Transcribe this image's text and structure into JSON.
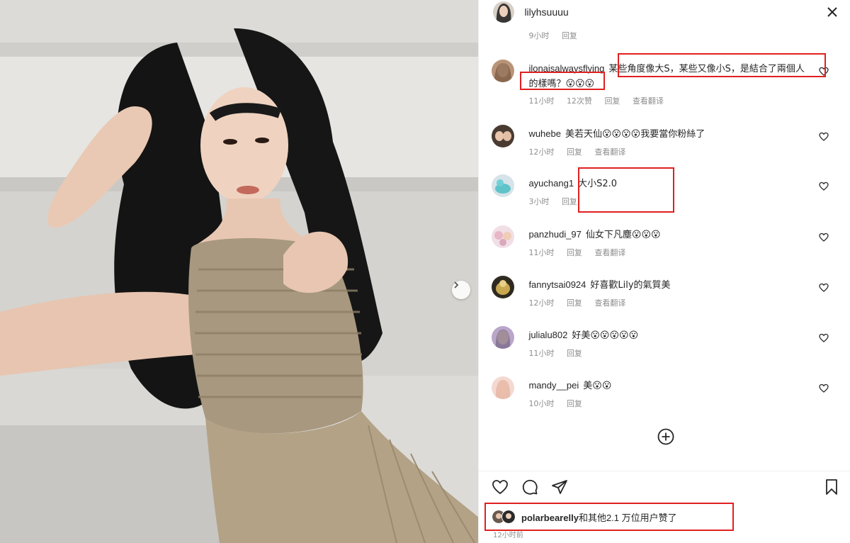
{
  "header": {
    "username": "lilyhsuuuu",
    "close_icon": "close-icon"
  },
  "previous_comment_meta": {
    "time": "9小时",
    "reply": "回复"
  },
  "comments": [
    {
      "username": "ilonaisalwaysflying",
      "text": "某些角度像大S，某些又像小S，是結合了兩個人的樣嗎？😮😮😮",
      "time": "11小时",
      "likes": "12次赞",
      "reply": "回复",
      "translate": "查看翻译"
    },
    {
      "username": "wuhebe",
      "text": "美若天仙😮😮😮😮我要當你粉絲了",
      "time": "12小时",
      "reply": "回复",
      "translate": "查看翻译"
    },
    {
      "username": "ayuchang1",
      "text": "大小S2.0",
      "time": "3小时",
      "reply": "回复"
    },
    {
      "username": "panzhudi_97",
      "text": "仙女下凡塵😮😮😮",
      "time": "11小时",
      "reply": "回复",
      "translate": "查看翻译"
    },
    {
      "username": "fannytsai0924",
      "text": "好喜歡Lily的氣質美",
      "time": "12小时",
      "reply": "回复",
      "translate": "查看翻译"
    },
    {
      "username": "julialu802",
      "text": "好美😮😮😮😮😮",
      "time": "11小时",
      "reply": "回复"
    },
    {
      "username": "mandy__pei",
      "text": "美😮😮",
      "time": "10小时",
      "reply": "回复"
    }
  ],
  "likes": {
    "user": "polarbearelly",
    "rest": "和其他2.1 万位用户赞了"
  },
  "timestamp": "12小时前",
  "icons": {
    "like": "heart-icon",
    "comment": "comment-icon",
    "share": "send-icon",
    "save": "bookmark-icon",
    "load_more": "plus-circle-icon",
    "next": "chevron-right-icon"
  },
  "colors": {
    "highlight_box": "#e02020",
    "meta_text": "#8e8e8e",
    "primary_text": "#262626"
  }
}
